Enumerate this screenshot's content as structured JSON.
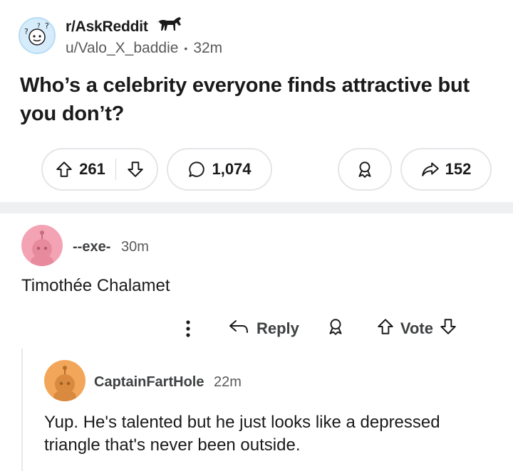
{
  "post": {
    "subreddit": "r/AskReddit",
    "author": "u/Valo_X_baddie",
    "separator": "•",
    "age": "32m",
    "title": "Who’s a celebrity everyone finds attractive but you don’t?",
    "icons": {
      "subreddit_avatar": "question-mark-avatar-icon",
      "flair": "horse-flair-icon"
    }
  },
  "actions": {
    "upvotes": "261",
    "comments": "1,074",
    "shares": "152",
    "icons": [
      "upvote-icon",
      "downvote-icon",
      "comment-icon",
      "award-icon",
      "share-icon"
    ]
  },
  "comments": [
    {
      "author": "--exe-",
      "age": "30m",
      "body": "Timothée Chalamet",
      "avatar_color": "#f3a3b4",
      "actions": {
        "reply": "Reply",
        "vote": "Vote"
      }
    },
    {
      "author": "CaptainFartHole",
      "age": "22m",
      "body": "Yup. He's talented but he just looks like a depressed triangle that's never been outside.",
      "avatar_color": "#f2a65a"
    }
  ],
  "colors": {
    "text": "#1a1a1b",
    "muted": "#5a5a5c",
    "divider": "#eef0f2",
    "pill_border": "#e3e5e8"
  }
}
